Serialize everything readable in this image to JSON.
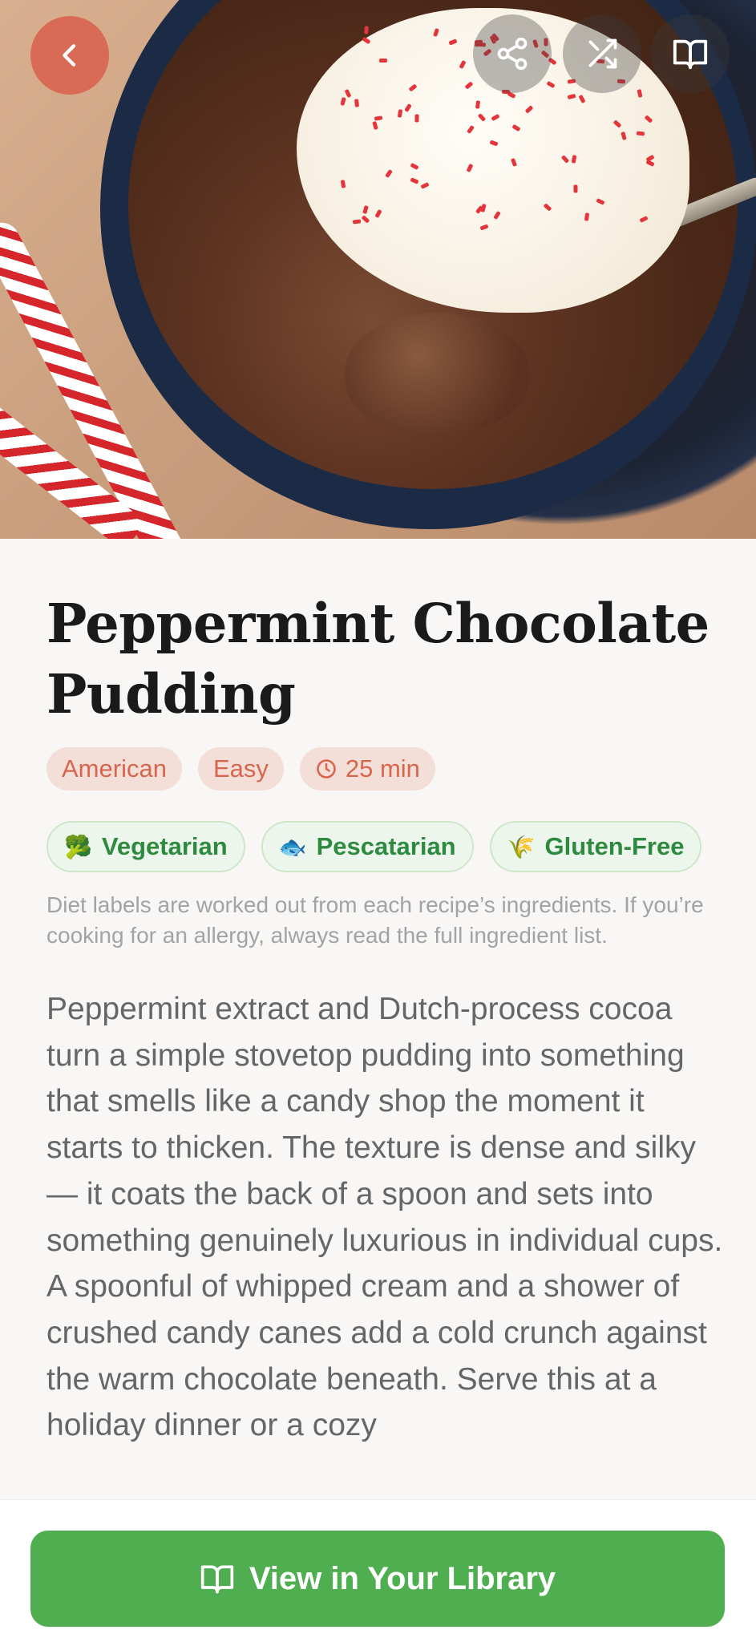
{
  "header": {
    "back_icon": "chevron-left-icon",
    "share_icon": "share-icon",
    "shuffle_icon": "shuffle-icon",
    "library_icon": "book-open-icon"
  },
  "recipe": {
    "title": "Peppermint Chocolate Pudding",
    "chips": [
      "American",
      "Easy",
      "25 min"
    ],
    "diet_labels": [
      {
        "emoji": "🥦",
        "label": "Vegetarian"
      },
      {
        "emoji": "🐟",
        "label": "Pescatarian"
      },
      {
        "emoji": "🌾",
        "label": "Gluten-Free"
      }
    ],
    "diet_note": "Diet labels are worked out from each recipe’s ingredients. If you’re cooking for an allergy, always read the full ingredient list.",
    "description": "Peppermint extract and Dutch-process cocoa turn a simple stovetop pudding into something that smells like a candy shop the moment it starts to thicken. The texture is dense and silky — it coats the back of a spoon and sets into something genuinely luxurious in individual cups. A spoonful of whipped cream and a shower of crushed candy canes add a cold crunch against the warm chocolate beneath. Serve this at a holiday dinner or a cozy"
  },
  "footer": {
    "cta_label": "View in Your Library"
  },
  "colors": {
    "accent": "#d86a56",
    "chip_bg": "#f4dfd8",
    "diet_green": "#2e8a3f",
    "cta_green": "#4fae4f"
  }
}
